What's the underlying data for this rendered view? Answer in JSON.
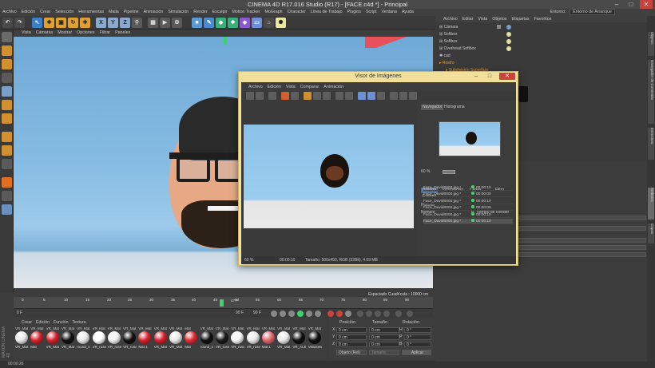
{
  "window": {
    "title": "CINEMA 4D R17.016 Studio (R17) - [FACE.c4d *] - Principal",
    "min": "–",
    "max": "□",
    "close": "✕"
  },
  "menubar": [
    "Archivo",
    "Edición",
    "Crear",
    "Selección",
    "Herramientas",
    "Malla",
    "Pipeline",
    "Animación",
    "Simulación",
    "Render",
    "Esculpir",
    "Motion Tracker",
    "MoGraph",
    "Character",
    "Línea de Trabajo",
    "Plugins",
    "Script",
    "Ventana",
    "Ayuda"
  ],
  "layout": {
    "label": "Entorno:",
    "value": "Entorno de Arranque"
  },
  "viewport": {
    "menu": [
      "Vista",
      "Cámaras",
      "Mostrar",
      "Opciones",
      "Filtrar",
      "Paneles"
    ],
    "grid_info": "Espaciado Cuadrícula : 10000 cm"
  },
  "timeline": {
    "ticks": [
      "0",
      "5",
      "10",
      "15",
      "20",
      "25",
      "30",
      "35",
      "40",
      "45",
      "50",
      "55",
      "60",
      "65",
      "70",
      "75",
      "80",
      "85",
      "90"
    ],
    "current": "47 F",
    "start": "0 F",
    "end": "90 F",
    "end2": "90 F",
    "frame": "47 F"
  },
  "materials": {
    "menu": [
      "Crear",
      "Edición",
      "Función",
      "Textura"
    ],
    "items": [
      {
        "top": "VR_Mat",
        "label": "VR_Mat",
        "color": "#e8e8e8"
      },
      {
        "top": "VR_Mat",
        "label": "Mat",
        "color": "#d8222c"
      },
      {
        "top": "VR_Mat",
        "label": "VR_Mat",
        "color": "#d8222c"
      },
      {
        "top": "VR_Mat",
        "label": "VR_Mat",
        "color": "#111111"
      },
      {
        "top": "VR_Mat",
        "label": "round_s",
        "color": "#e8e8e8"
      },
      {
        "top": "VR_Mat",
        "label": "VR_ruse",
        "color": "#ffffff"
      },
      {
        "top": "VR_Mat",
        "label": "VR_ruse",
        "color": "#f0f0f0"
      },
      {
        "top": "VR_Mat",
        "label": "VR_ruse",
        "color": "#111111"
      },
      {
        "top": "VR_Mat",
        "label": "Mat.1",
        "color": "#d8222c"
      },
      {
        "top": "VR_Mat",
        "label": "VR_Mat",
        "color": "#d8222c"
      },
      {
        "top": "VR_Mat",
        "label": "VR_Mat",
        "color": "#e8e8e8"
      },
      {
        "top": "Mat",
        "label": "Mat",
        "color": "#e02a33"
      },
      {
        "top": "VR_Mat",
        "label": "round_s",
        "color": "#111111"
      },
      {
        "top": "VR_Mat",
        "label": "VR_ruse",
        "color": "#1a1a1a"
      },
      {
        "top": "VR_Mat",
        "label": "VR_ruse",
        "color": "#f4f4f4"
      },
      {
        "top": "VR_Mat",
        "label": "VR_ruse",
        "color": "#e8e8e8"
      },
      {
        "top": "VR_Mat",
        "label": "Mat.1",
        "color": "#e0656b"
      },
      {
        "top": "VR_Mat",
        "label": "VR_Mat",
        "color": "#e8e8e8"
      },
      {
        "top": "VR_Mat",
        "label": "VR_ALB",
        "color": "#111111"
      },
      {
        "top": "VR_Mat",
        "label": "VrBaseMt",
        "color": "#101010"
      }
    ]
  },
  "coords": {
    "headers": [
      "Posición",
      "Tamaño",
      "Rotación"
    ],
    "rows": [
      {
        "axis": "X",
        "pos": "0 cm",
        "size": "0 cm",
        "rlabel": "H",
        "rot": "0 °"
      },
      {
        "axis": "Y",
        "pos": "0 cm",
        "size": "0 cm",
        "rlabel": "P",
        "rot": "0 °"
      },
      {
        "axis": "Z",
        "pos": "0 cm",
        "size": "0 cm",
        "rlabel": "B",
        "rot": "0 °"
      }
    ],
    "mode": "Objeto (Rel)",
    "size_mode": "Tamaño",
    "apply": "Aplicar"
  },
  "object_manager": {
    "menu": [
      "Archivo",
      "Editar",
      "Vista",
      "Objetos",
      "Etiquetas",
      "Favoritos"
    ],
    "objects": [
      "Cámara",
      "Softbox",
      "Softbox",
      "Overhead Softbox",
      "cad",
      "Rostro",
      "Subdivisión Superficie"
    ]
  },
  "picture_viewer": {
    "title": "Visor de Imágenes",
    "menu": [
      "Archivo",
      "Edición",
      "Vista",
      "Comparar",
      "Animación"
    ],
    "tabs_top": [
      "Navegador",
      "Histograma"
    ],
    "nav_zoom": "60 %",
    "tabs_info": [
      "Historia",
      "Información",
      "Capas",
      "Filtro",
      "Estéreo"
    ],
    "history_label": "Historia",
    "columns": [
      "Nombre",
      "R",
      "Tiempo de Render"
    ],
    "history": [
      {
        "name": "Face_David0000.jpg *",
        "time": "00:00:10"
      },
      {
        "name": "Face_David0000.jpg *",
        "time": "00:00:00"
      },
      {
        "name": "Face_David0000.jpg *",
        "time": "00:00:10"
      },
      {
        "name": "Face_David0000.jpg *",
        "time": "00:00:09"
      },
      {
        "name": "Face_David0000.jpg *",
        "time": "00:00:10"
      },
      {
        "name": "Face_David0000.jpg *",
        "time": "00:00:10"
      }
    ],
    "zoom": "60 %",
    "time": "00:00:10",
    "size_info": "Tamaño: 500x450, RGB (32Bit), 4.09 MB"
  },
  "status": "00:00:26",
  "right_tabs": [
    "Objetos",
    "Navegador de Contenido",
    "Estructura",
    "Atributos",
    "Capas"
  ],
  "brand": "MAXON CINEMA 4D"
}
